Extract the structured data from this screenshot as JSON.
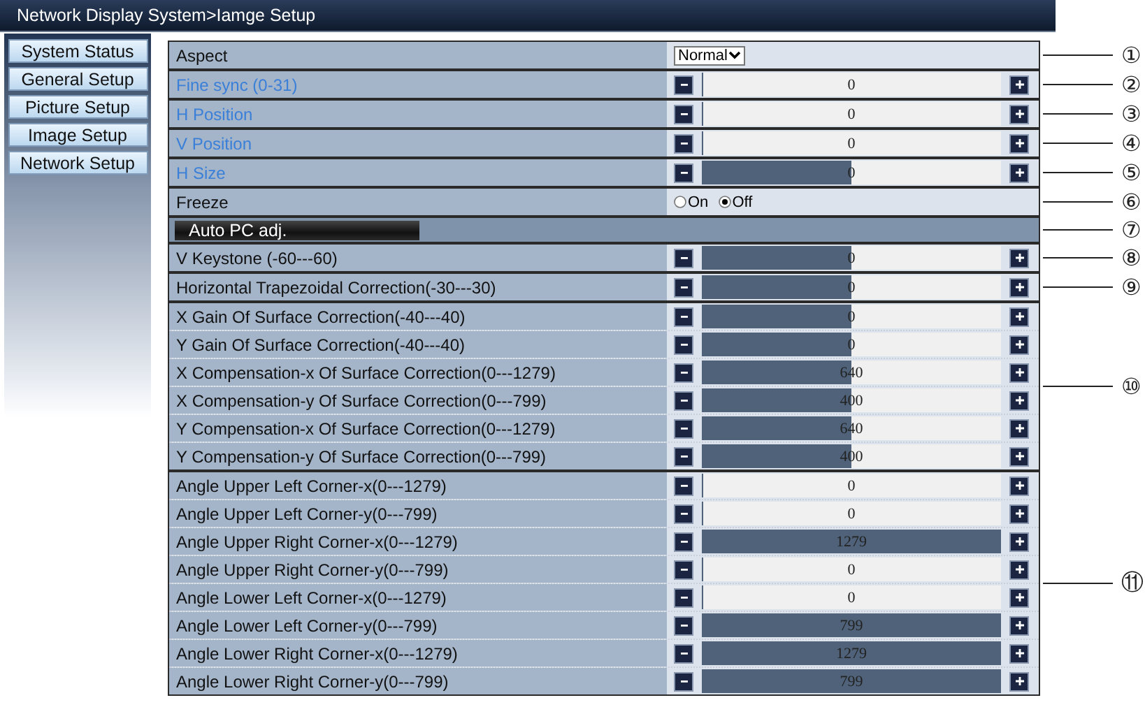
{
  "window": {
    "title": "Network Display System>Iamge Setup"
  },
  "sidebar": {
    "items": [
      {
        "label": "System Status"
      },
      {
        "label": "General Setup"
      },
      {
        "label": "Picture Setup"
      },
      {
        "label": "Image Setup"
      },
      {
        "label": "Network Setup"
      }
    ]
  },
  "groups": [
    {
      "callout": "①",
      "rows": [
        {
          "kind": "select",
          "label": "Aspect",
          "disabled": false,
          "value": "Normal"
        }
      ]
    },
    {
      "callout": "②",
      "rows": [
        {
          "kind": "slider",
          "label": "Fine sync (0-31)",
          "disabled": true,
          "value": "0",
          "level": 0
        }
      ]
    },
    {
      "callout": "③",
      "rows": [
        {
          "kind": "slider",
          "label": "H Position",
          "disabled": true,
          "value": "0",
          "level": 0
        }
      ]
    },
    {
      "callout": "④",
      "rows": [
        {
          "kind": "slider",
          "label": "V Position",
          "disabled": true,
          "value": "0",
          "level": 0
        }
      ]
    },
    {
      "callout": "⑤",
      "rows": [
        {
          "kind": "slider",
          "label": "H Size",
          "disabled": true,
          "value": "0",
          "level": 0.5
        }
      ]
    },
    {
      "callout": "⑥",
      "rows": [
        {
          "kind": "radio",
          "label": "Freeze",
          "disabled": false,
          "options": [
            {
              "label": "On",
              "selected": false
            },
            {
              "label": "Off",
              "selected": true
            }
          ]
        }
      ]
    },
    {
      "callout": "⑦",
      "rows": [
        {
          "kind": "button",
          "label": "Auto PC adj."
        }
      ]
    },
    {
      "callout": "⑧",
      "rows": [
        {
          "kind": "slider",
          "label": "V Keystone (-60---60)",
          "disabled": false,
          "value": "0",
          "level": 0.5
        }
      ]
    },
    {
      "callout": "⑨",
      "rows": [
        {
          "kind": "slider",
          "label": "Horizontal Trapezoidal Correction(-30---30)",
          "disabled": false,
          "value": "0",
          "level": 0.5
        }
      ]
    },
    {
      "callout": "⑩",
      "rows": [
        {
          "kind": "slider",
          "label": "X Gain Of Surface Correction(-40---40)",
          "disabled": false,
          "value": "0",
          "level": 0.5
        },
        {
          "kind": "slider",
          "label": "Y Gain Of Surface Correction(-40---40)",
          "disabled": false,
          "value": "0",
          "level": 0.5
        },
        {
          "kind": "slider",
          "label": "X Compensation-x Of Surface Correction(0---1279)",
          "disabled": false,
          "value": "640",
          "level": 0.5
        },
        {
          "kind": "slider",
          "label": "X Compensation-y Of Surface Correction(0---799)",
          "disabled": false,
          "value": "400",
          "level": 0.5
        },
        {
          "kind": "slider",
          "label": "Y Compensation-x Of Surface Correction(0---1279)",
          "disabled": false,
          "value": "640",
          "level": 0.5
        },
        {
          "kind": "slider",
          "label": "Y Compensation-y Of Surface Correction(0---799)",
          "disabled": false,
          "value": "400",
          "level": 0.5
        }
      ]
    },
    {
      "callout": "⑪",
      "rows": [
        {
          "kind": "slider",
          "label": "Angle Upper Left Corner-x(0---1279)",
          "disabled": false,
          "value": "0",
          "level": 0
        },
        {
          "kind": "slider",
          "label": "Angle Upper Left Corner-y(0---799)",
          "disabled": false,
          "value": "0",
          "level": 0
        },
        {
          "kind": "slider",
          "label": "Angle Upper Right Corner-x(0---1279)",
          "disabled": false,
          "value": "1279",
          "level": 1
        },
        {
          "kind": "slider",
          "label": "Angle Upper Right Corner-y(0---799)",
          "disabled": false,
          "value": "0",
          "level": 0
        },
        {
          "kind": "slider",
          "label": "Angle Lower Left Corner-x(0---1279)",
          "disabled": false,
          "value": "0",
          "level": 0
        },
        {
          "kind": "slider",
          "label": "Angle Lower Left Corner-y(0---799)",
          "disabled": false,
          "value": "799",
          "level": 1
        },
        {
          "kind": "slider",
          "label": "Angle Lower Right Corner-x(0---1279)",
          "disabled": false,
          "value": "1279",
          "level": 1
        },
        {
          "kind": "slider",
          "label": "Angle Lower Right Corner-y(0---799)",
          "disabled": false,
          "value": "799",
          "level": 1
        }
      ]
    }
  ]
}
